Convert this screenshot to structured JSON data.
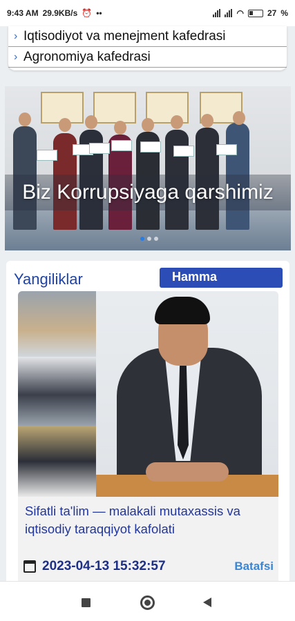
{
  "status_bar": {
    "time": "9:43 AM",
    "net_speed": "29.9KB/s",
    "extra": "••",
    "battery": "27"
  },
  "department_list": {
    "items": [
      {
        "label": "Iqtisodiyot va menejment kafedrasi"
      },
      {
        "label": "Agronomiya kafedrasi"
      }
    ]
  },
  "slider": {
    "caption": "Biz Korrupsiyaga qarshimiz",
    "slide_count": 3,
    "active_index": 0
  },
  "news": {
    "title": "Yangiliklar",
    "all_button": "Hamma",
    "items": [
      {
        "headline": "Sifatli ta'lim — malakali mutaxassis va iqtisodiy taraqqiyot kafolati",
        "date": "2023-04-13 15:32:57",
        "more": "Batafsi"
      }
    ]
  },
  "colors": {
    "accent": "#2c4cb6",
    "link": "#3a86d6",
    "heading": "#1f43a6"
  },
  "icons": {
    "alarm": "alarm-icon",
    "wifi": "wifi-icon",
    "calendar": "calendar-icon",
    "chevron": "chevron-right-icon"
  }
}
